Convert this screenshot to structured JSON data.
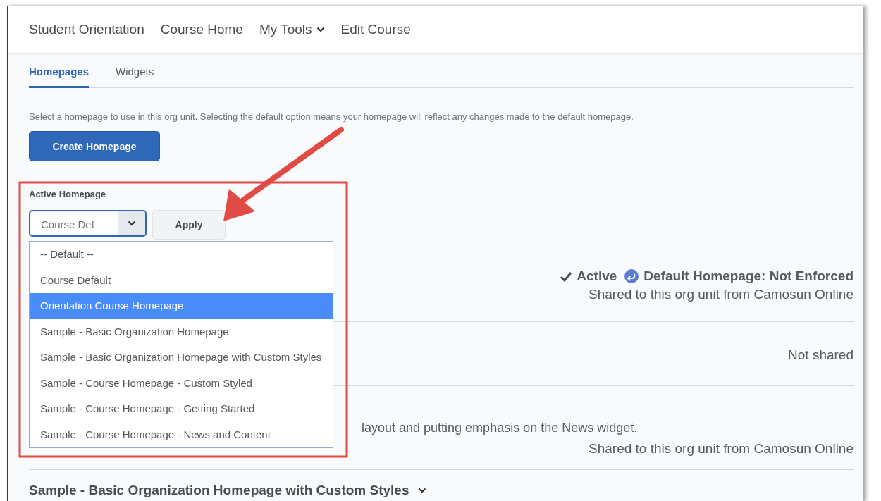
{
  "nav": [
    {
      "label": "Student Orientation",
      "has_menu": false
    },
    {
      "label": "Course Home",
      "has_menu": false
    },
    {
      "label": "My Tools",
      "has_menu": true
    },
    {
      "label": "Edit Course",
      "has_menu": false
    }
  ],
  "tabs": [
    {
      "label": "Homepages",
      "selected": true
    },
    {
      "label": "Widgets",
      "selected": false
    }
  ],
  "description": "Select a homepage to use in this org unit. Selecting the default option means your homepage will reflect any changes made to the default homepage.",
  "create_button": "Create Homepage",
  "active_homepage": {
    "label": "Active Homepage",
    "value": "Course Def",
    "apply_button": "Apply",
    "options": [
      {
        "label": "-- Default --",
        "selected": false
      },
      {
        "label": "Course Default",
        "selected": false
      },
      {
        "label": "Orientation Course Homepage",
        "selected": true
      },
      {
        "label": "Sample - Basic Organization Homepage",
        "selected": false
      },
      {
        "label": "Sample - Basic Organization Homepage with Custom Styles",
        "selected": false
      },
      {
        "label": "Sample - Course Homepage - Custom Styled",
        "selected": false
      },
      {
        "label": "Sample - Course Homepage - Getting Started",
        "selected": false
      },
      {
        "label": "Sample - Course Homepage - News and Content",
        "selected": false
      }
    ]
  },
  "homepages": [
    {
      "active": true,
      "active_label": "Active",
      "default_label": "Default Homepage: Not Enforced",
      "sharing": "Shared to this org unit from Camosun Online"
    },
    {
      "active": false,
      "sharing": "Not shared"
    },
    {
      "active": false,
      "description": "layout and putting emphasis on the News widget.",
      "sharing": "Shared to this org unit from Camosun Online"
    },
    {
      "active": false,
      "title": "Sample - Basic Organization Homepage with Custom Styles"
    }
  ]
}
